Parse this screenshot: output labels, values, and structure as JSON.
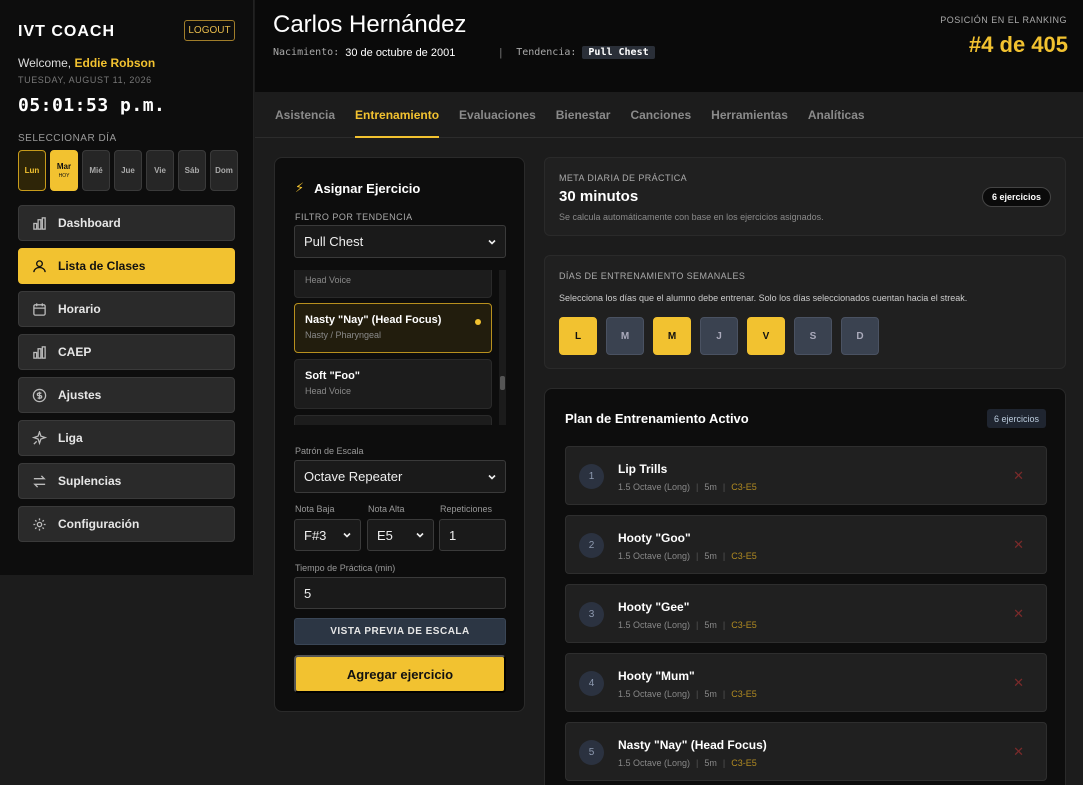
{
  "sidebar": {
    "brand": "IVT COACH",
    "logout": "LOGOUT",
    "welcome_prefix": "Welcome,",
    "user_name": "Eddie Robson",
    "date": "TUESDAY, AUGUST 11, 2026",
    "clock": "05:01:53 p.m.",
    "select_day_label": "SELECCIONAR DÍA",
    "days": [
      {
        "label": "Lun",
        "state": "selected"
      },
      {
        "label": "Mar",
        "state": "today",
        "sub": "HOY"
      },
      {
        "label": "Mié",
        "state": "normal"
      },
      {
        "label": "Jue",
        "state": "normal"
      },
      {
        "label": "Vie",
        "state": "normal"
      },
      {
        "label": "Sáb",
        "state": "normal"
      },
      {
        "label": "Dom",
        "state": "normal"
      }
    ],
    "nav": [
      {
        "label": "Dashboard",
        "icon": "bar-chart-icon",
        "active": false
      },
      {
        "label": "Lista de Clases",
        "icon": "users-icon",
        "active": true
      },
      {
        "label": "Horario",
        "icon": "calendar-icon",
        "active": false
      },
      {
        "label": "CAEP",
        "icon": "bar-chart-icon",
        "active": false
      },
      {
        "label": "Ajustes",
        "icon": "dollar-icon",
        "active": false
      },
      {
        "label": "Liga",
        "icon": "sparkle-icon",
        "active": false
      },
      {
        "label": "Suplencias",
        "icon": "swap-icon",
        "active": false
      },
      {
        "label": "Configuración",
        "icon": "gear-icon",
        "active": false
      }
    ]
  },
  "header": {
    "student_name": "Carlos Hernández",
    "birth_label": "Nacimiento:",
    "birth_value": "30 de octubre de 2001",
    "separator": "|",
    "trend_label": "Tendencia:",
    "trend_value": "Pull Chest",
    "rank_label": "POSICIÓN EN EL RANKING",
    "rank_value": "#4 de 405"
  },
  "tabs": [
    {
      "label": "Asistencia",
      "active": false
    },
    {
      "label": "Entrenamiento",
      "active": true
    },
    {
      "label": "Evaluaciones",
      "active": false
    },
    {
      "label": "Bienestar",
      "active": false
    },
    {
      "label": "Canciones",
      "active": false
    },
    {
      "label": "Herramientas",
      "active": false
    },
    {
      "label": "Analíticas",
      "active": false
    }
  ],
  "assign": {
    "title": "Asignar Ejercicio",
    "filter_label": "FILTRO POR TENDENCIA",
    "filter_value": "Pull Chest",
    "exercises": [
      {
        "name": "",
        "sub": "Head Voice",
        "selected": false
      },
      {
        "name": "Nasty \"Nay\" (Head Focus)",
        "sub": "Nasty / Pharyngeal",
        "selected": true
      },
      {
        "name": "Soft \"Foo\"",
        "sub": "Head Voice",
        "selected": false
      }
    ],
    "scale_label": "Patrón de Escala",
    "scale_value": "Octave Repeater",
    "low_label": "Nota Baja",
    "low_value": "F#3",
    "high_label": "Nota Alta",
    "high_value": "E5",
    "reps_label": "Repeticiones",
    "reps_value": "1",
    "time_label": "Tiempo de Práctica (min)",
    "time_value": "5",
    "preview_button": "VISTA PREVIA DE ESCALA",
    "add_button": "Agregar ejercicio"
  },
  "meta": {
    "label": "META DIARIA DE PRÁCTICA",
    "value": "30 minutos",
    "note": "Se calcula automáticamente con base en los ejercicios asignados.",
    "badge": "6 ejercicios"
  },
  "weekly": {
    "label": "DÍAS DE ENTRENAMIENTO SEMANALES",
    "note": "Selecciona los días que el alumno debe entrenar. Solo los días seleccionados cuentan hacia el streak.",
    "days": [
      {
        "label": "L",
        "on": true
      },
      {
        "label": "M",
        "on": false
      },
      {
        "label": "M",
        "on": true
      },
      {
        "label": "J",
        "on": false
      },
      {
        "label": "V",
        "on": true
      },
      {
        "label": "S",
        "on": false
      },
      {
        "label": "D",
        "on": false
      }
    ]
  },
  "plan": {
    "title": "Plan de Entrenamiento Activo",
    "badge": "6 ejercicios",
    "items": [
      {
        "num": "1",
        "name": "Lip Trills",
        "pattern": "1.5 Octave (Long)",
        "time": "5m",
        "range": "C3-E5"
      },
      {
        "num": "2",
        "name": "Hooty \"Goo\"",
        "pattern": "1.5 Octave (Long)",
        "time": "5m",
        "range": "C3-E5"
      },
      {
        "num": "3",
        "name": "Hooty \"Gee\"",
        "pattern": "1.5 Octave (Long)",
        "time": "5m",
        "range": "C3-E5"
      },
      {
        "num": "4",
        "name": "Hooty \"Mum\"",
        "pattern": "1.5 Octave (Long)",
        "time": "5m",
        "range": "C3-E5"
      },
      {
        "num": "5",
        "name": "Nasty \"Nay\" (Head Focus)",
        "pattern": "1.5 Octave (Long)",
        "time": "5m",
        "range": "C3-E5"
      }
    ]
  },
  "colors": {
    "accent": "#f2c230",
    "background": "#1c1c1c",
    "panel": "#0d0d0d"
  }
}
